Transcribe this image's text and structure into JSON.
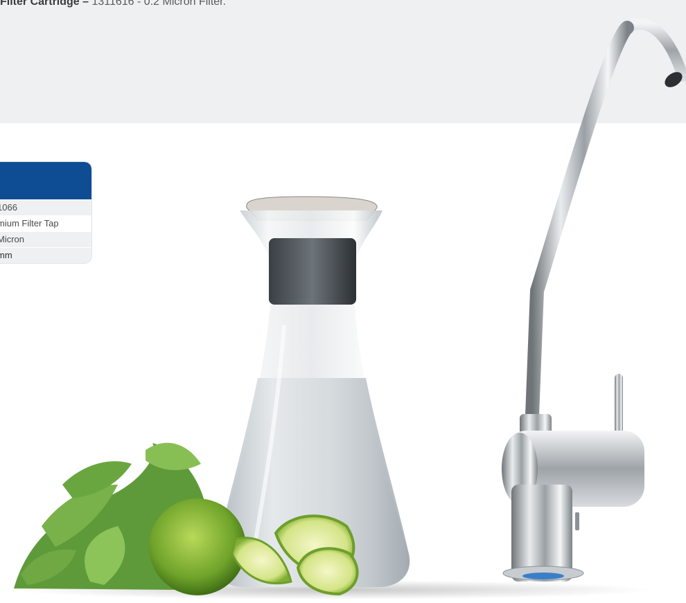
{
  "header": {
    "filter_label": "Filter Cartridge –",
    "filter_value": " 1311616 - 0.2 Micron Filter."
  },
  "spec_table": {
    "rows": [
      "1066",
      "mium Filter Tap",
      "Micron",
      "mm"
    ]
  },
  "colors": {
    "table_header": "#0e4d94",
    "top_band": "#eef0f2"
  },
  "images": {
    "carafe": "water-carafe",
    "tap": "chrome-filter-tap",
    "garnish": "mint-and-limes"
  }
}
